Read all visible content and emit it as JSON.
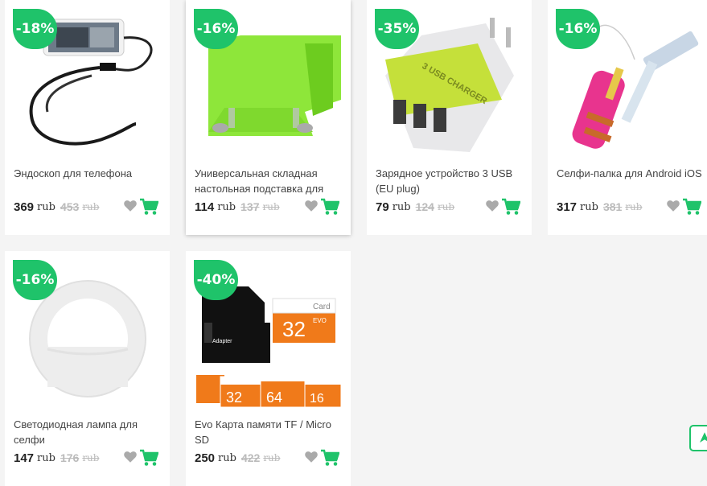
{
  "currency": "rub",
  "products": [
    {
      "discount": "-18%",
      "title": "Эндоскоп для телефона",
      "price": "369",
      "old_price": "453"
    },
    {
      "discount": "-16%",
      "title": "Универсальная складная настольная подставка для",
      "price": "114",
      "old_price": "137"
    },
    {
      "discount": "-35%",
      "title": "Зарядное устройство 3 USB (EU plug)",
      "price": "79",
      "old_price": "124"
    },
    {
      "discount": "-16%",
      "title": "Селфи-палка для Android iOS",
      "price": "317",
      "old_price": "381"
    },
    {
      "discount": "-16%",
      "title": "Светодиодная лампа для селфи",
      "price": "147",
      "old_price": "176"
    },
    {
      "discount": "-40%",
      "title": "Evo Карта памяти TF / Micro SD",
      "price": "250",
      "old_price": "422"
    }
  ],
  "image_text": {
    "charger": "3 USB CHARGER",
    "card_label": "Card",
    "card_evo": "EVO",
    "card_32": "32",
    "card_64": "64",
    "card_16": "16",
    "adapter": "Adapter"
  },
  "colors": {
    "accent": "#1fc36a",
    "heart": "#aaaaaa"
  },
  "icons": [
    "heart-icon",
    "cart-icon",
    "arrow-up-icon"
  ]
}
